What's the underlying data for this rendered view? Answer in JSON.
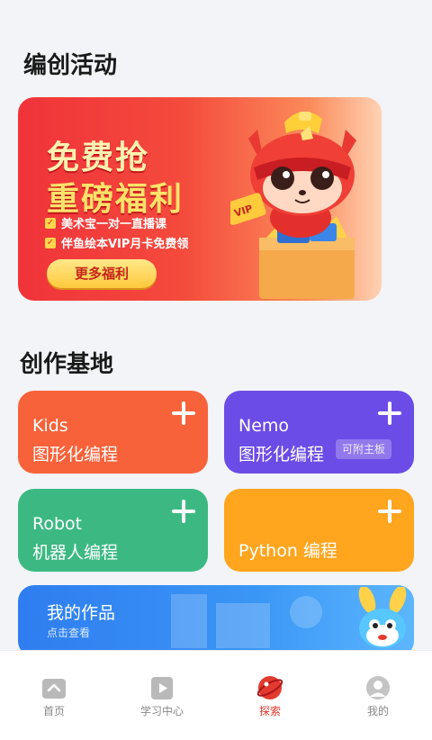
{
  "sections": {
    "activities_title": "编创活动",
    "base_title": "创作基地"
  },
  "banner": {
    "headline_1": "免费抢",
    "headline_2": "重磅福利",
    "bullets": [
      "美术宝一对一直播课",
      "伴鱼绘本VIP月卡免费领"
    ],
    "button_label": "更多福利",
    "vip_tag": "VIP"
  },
  "cards": {
    "kids": {
      "line1": "Kids",
      "line2": "图形化编程"
    },
    "nemo": {
      "line1": "Nemo",
      "line2": "图形化编程",
      "badge": "可附主板"
    },
    "robot": {
      "line1": "Robot",
      "line2": "机器人编程"
    },
    "python": {
      "label": "Python 编程"
    }
  },
  "works": {
    "title": "我的作品",
    "subtitle": "点击查看"
  },
  "tabs": [
    {
      "label": "首页",
      "icon": "home-icon",
      "active": false
    },
    {
      "label": "学习中心",
      "icon": "play-icon",
      "active": false
    },
    {
      "label": "探索",
      "icon": "explore-icon",
      "active": true
    },
    {
      "label": "我的",
      "icon": "profile-icon",
      "active": false
    }
  ],
  "colors": {
    "accent_red": "#e33a2f",
    "kids_card": "#f8623a",
    "nemo_card": "#6c4ce6",
    "robot_card": "#3cb982",
    "python_card": "#ffa51e",
    "works_card": "#2f7df0"
  }
}
